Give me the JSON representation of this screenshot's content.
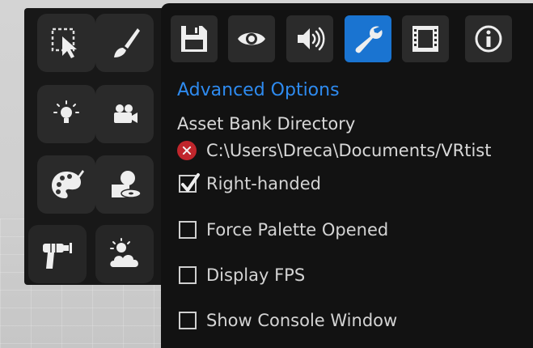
{
  "palette": {
    "tools": [
      {
        "icon": "selection-cursor-icon"
      },
      {
        "icon": "paint-brush-icon"
      },
      {
        "icon": "light-bulb-icon"
      },
      {
        "icon": "camera-icon"
      },
      {
        "icon": "color-palette-icon"
      },
      {
        "icon": "import-disc-icon"
      },
      {
        "icon": "ray-gun-icon"
      },
      {
        "icon": "sky-weather-icon"
      }
    ]
  },
  "settings": {
    "tabs": [
      {
        "icon": "save-icon",
        "active": false
      },
      {
        "icon": "eye-icon",
        "active": false
      },
      {
        "icon": "speaker-icon",
        "active": false
      },
      {
        "icon": "wrench-icon",
        "active": true
      },
      {
        "icon": "film-icon",
        "active": false
      },
      {
        "icon": "info-icon",
        "active": false
      }
    ],
    "section_title": "Advanced Options",
    "asset_bank_label": "Asset Bank Directory",
    "asset_bank_path": "C:\\Users\\Dreca\\Documents/VRtist",
    "asset_bank_status_icon": "error-x-icon",
    "options": {
      "right_handed": {
        "label": "Right-handed",
        "checked": true
      },
      "force_palette": {
        "label": "Force Palette Opened",
        "checked": false
      },
      "display_fps": {
        "label": "Display FPS",
        "checked": false
      },
      "show_console": {
        "label": "Show Console Window",
        "checked": false
      }
    }
  },
  "colors": {
    "accent": "#1a74d1",
    "title": "#2e8bf0",
    "error": "#c0262c"
  }
}
